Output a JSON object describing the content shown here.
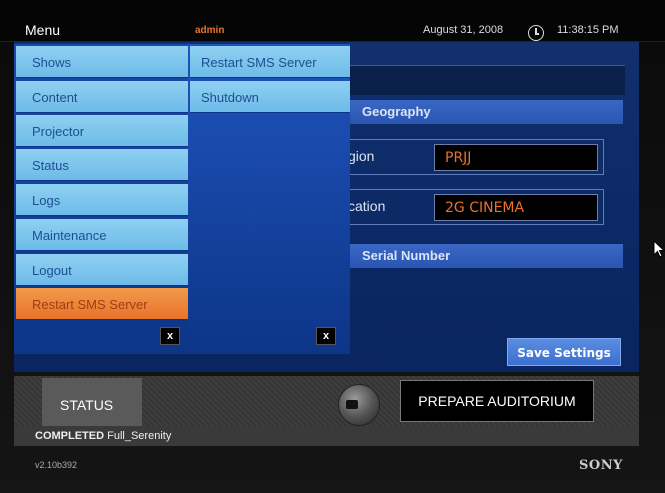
{
  "header": {
    "menu_label": "Menu",
    "user": "admin",
    "date": "August 31, 2008",
    "time": "11:38:15 PM"
  },
  "menu": {
    "items": [
      {
        "label": "Shows"
      },
      {
        "label": "Content"
      },
      {
        "label": "Projector"
      },
      {
        "label": "Status"
      },
      {
        "label": "Logs"
      },
      {
        "label": "Maintenance"
      },
      {
        "label": "Logout"
      },
      {
        "label": "Restart SMS Server"
      }
    ],
    "active": "Restart SMS Server",
    "submenu": [
      {
        "label": "Restart SMS Server"
      },
      {
        "label": "Shutdown"
      }
    ],
    "close_label": "x"
  },
  "panel": {
    "geography_header": "Geography",
    "region_label": "gion",
    "region_value": "PRJJ",
    "location_label": "cation",
    "location_value": "2G CINEMA",
    "serial_header": "Serial Number",
    "save_label": "Save Settings"
  },
  "bottom": {
    "status_label": "STATUS",
    "prepare_label": "PREPARE AUDITORIUM",
    "completed_prefix": "COMPLETED",
    "completed_show": "Full_Serenity",
    "version": "v2.10b392",
    "brand": "SONY"
  },
  "colors": {
    "accent": "#e8722a",
    "menu_item": "#7fc4ec",
    "panel_blue": "#0c2a66",
    "header_blue": "#3360c0"
  }
}
